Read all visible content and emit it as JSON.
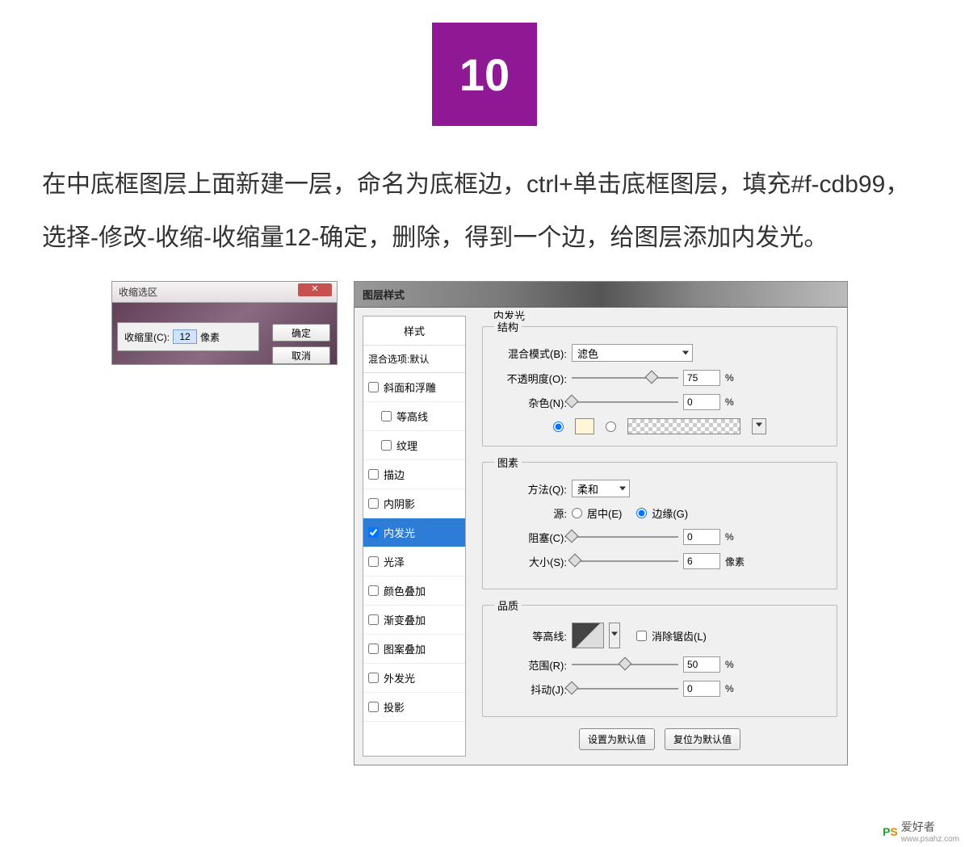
{
  "step": {
    "number": "10"
  },
  "instruction": "在中底框图层上面新建一层，命名为底框边，ctrl+单击底框图层，填充#f-cdb99，选择-修改-收缩-收缩量12-确定，删除，得到一个边，给图层添加内发光。",
  "contract_dialog": {
    "title": "收缩选区",
    "amount_label": "收缩里(C):",
    "amount_value": "12",
    "unit": "像素",
    "ok": "确定",
    "cancel": "取消"
  },
  "layer_style": {
    "title": "图层样式",
    "sidebar": {
      "header": "样式",
      "blend_default": "混合选项:默认",
      "items": [
        {
          "label": "斜面和浮雕",
          "checked": false
        },
        {
          "label": "等高线",
          "checked": false,
          "indent": true
        },
        {
          "label": "纹理",
          "checked": false,
          "indent": true
        },
        {
          "label": "描边",
          "checked": false
        },
        {
          "label": "内阴影",
          "checked": false
        },
        {
          "label": "内发光",
          "checked": true,
          "active": true
        },
        {
          "label": "光泽",
          "checked": false
        },
        {
          "label": "颜色叠加",
          "checked": false
        },
        {
          "label": "渐变叠加",
          "checked": false
        },
        {
          "label": "图案叠加",
          "checked": false
        },
        {
          "label": "外发光",
          "checked": false
        },
        {
          "label": "投影",
          "checked": false
        }
      ]
    },
    "panel_title": "内发光",
    "structure": {
      "legend": "结构",
      "blend_mode_label": "混合模式(B):",
      "blend_mode_value": "滤色",
      "opacity_label": "不透明度(O):",
      "opacity_value": "75",
      "noise_label": "杂色(N):",
      "noise_value": "0",
      "percent": "%",
      "color_swatch": "#fff6d8"
    },
    "elements": {
      "legend": "图素",
      "technique_label": "方法(Q):",
      "technique_value": "柔和",
      "source_label": "源:",
      "source_center": "居中(E)",
      "source_edge": "边缘(G)",
      "source_selected": "edge",
      "choke_label": "阻塞(C):",
      "choke_value": "0",
      "size_label": "大小(S):",
      "size_value": "6",
      "size_unit": "像素"
    },
    "quality": {
      "legend": "品质",
      "contour_label": "等高线:",
      "antialias_label": "消除锯齿(L)",
      "range_label": "范围(R):",
      "range_value": "50",
      "jitter_label": "抖动(J):",
      "jitter_value": "0"
    },
    "bottom": {
      "make_default": "设置为默认值",
      "reset_default": "复位为默认值"
    }
  },
  "watermark": {
    "brand": "爱好者",
    "url": "www.psahz.com"
  }
}
